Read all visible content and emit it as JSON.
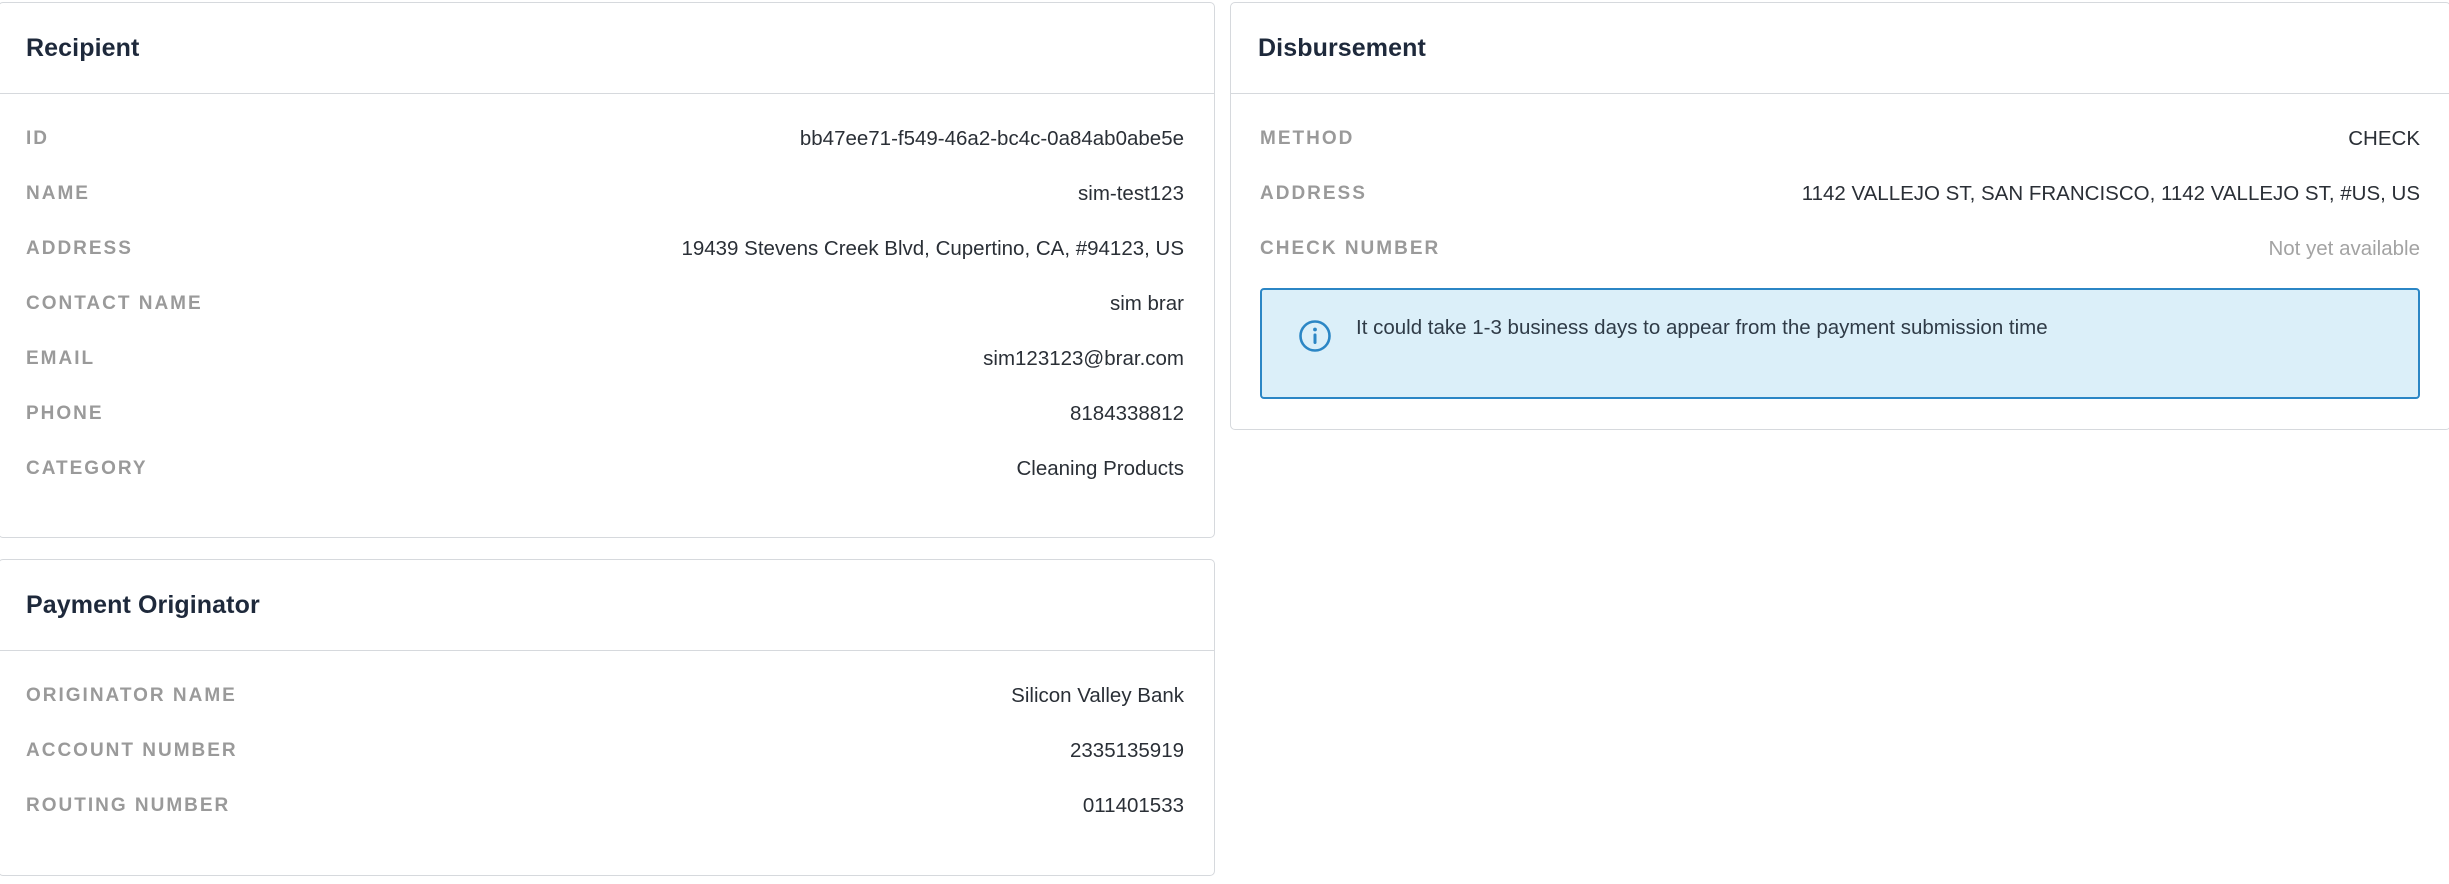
{
  "recipient": {
    "title": "Recipient",
    "rows": [
      {
        "label": "ID",
        "value": "bb47ee71-f549-46a2-bc4c-0a84ab0abe5e"
      },
      {
        "label": "NAME",
        "value": "sim-test123"
      },
      {
        "label": "ADDRESS",
        "value": "19439 Stevens Creek Blvd, Cupertino, CA, #94123, US"
      },
      {
        "label": "CONTACT NAME",
        "value": "sim brar"
      },
      {
        "label": "EMAIL",
        "value": "sim123123@brar.com"
      },
      {
        "label": "PHONE",
        "value": "8184338812"
      },
      {
        "label": "CATEGORY",
        "value": "Cleaning Products"
      }
    ]
  },
  "originator": {
    "title": "Payment Originator",
    "rows": [
      {
        "label": "ORIGINATOR NAME",
        "value": "Silicon Valley Bank"
      },
      {
        "label": "ACCOUNT NUMBER",
        "value": "2335135919"
      },
      {
        "label": "ROUTING NUMBER",
        "value": "011401533"
      }
    ]
  },
  "disbursement": {
    "title": "Disbursement",
    "rows": [
      {
        "label": "METHOD",
        "value": "CHECK"
      },
      {
        "label": "ADDRESS",
        "value": "1142 VALLEJO ST, SAN FRANCISCO, 1142 VALLEJO ST, #US, US"
      },
      {
        "label": "CHECK NUMBER",
        "value": "Not yet available"
      }
    ],
    "notice": {
      "icon": "info-icon",
      "text": "It could take 1-3 business days to appear from the payment submission time",
      "accent_color": "#2b86c5",
      "background_color": "#dbeff9"
    }
  }
}
